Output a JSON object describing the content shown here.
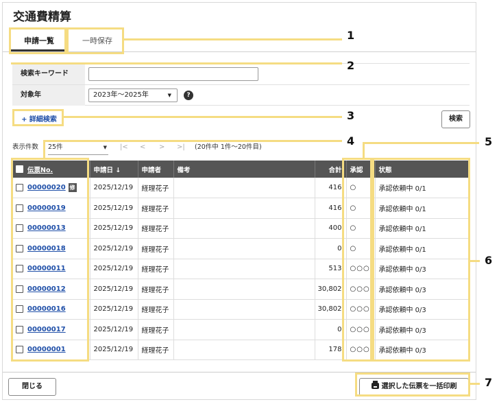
{
  "title": "交通費精算",
  "tabs": [
    {
      "label": "申請一覧",
      "active": true
    },
    {
      "label": "一時保存",
      "active": false
    }
  ],
  "search": {
    "keyword_label": "検索キーワード",
    "keyword_value": "",
    "year_label": "対象年",
    "year_value": "2023年〜2025年",
    "help_icon": "question-circle-icon",
    "detail_link": "+ 詳細検索",
    "search_button": "検索"
  },
  "pager": {
    "page_size_label": "表示件数",
    "page_size": "25件",
    "first": "|<",
    "prev": "<",
    "next": ">",
    "last": ">|",
    "info": "(20件中 1件〜20件目)"
  },
  "table": {
    "headers": {
      "doc_no": "伝票No.",
      "date": "申請日",
      "sort_indicator": "↓",
      "applicant": "申請者",
      "remarks": "備考",
      "total": "合計",
      "approval": "承認",
      "status": "状態"
    },
    "rows": [
      {
        "doc_no": "00000020",
        "badge": "修",
        "date": "2025/12/19",
        "applicant": "経理花子",
        "remarks": "",
        "total": "416",
        "approval": "○",
        "status": "承認依頼中 0/1"
      },
      {
        "doc_no": "00000019",
        "badge": "",
        "date": "2025/12/19",
        "applicant": "経理花子",
        "remarks": "",
        "total": "416",
        "approval": "○",
        "status": "承認依頼中 0/1"
      },
      {
        "doc_no": "00000013",
        "badge": "",
        "date": "2025/12/19",
        "applicant": "経理花子",
        "remarks": "",
        "total": "400",
        "approval": "○",
        "status": "承認依頼中 0/1"
      },
      {
        "doc_no": "00000018",
        "badge": "",
        "date": "2025/12/19",
        "applicant": "経理花子",
        "remarks": "",
        "total": "0",
        "approval": "○",
        "status": "承認依頼中 0/1"
      },
      {
        "doc_no": "00000011",
        "badge": "",
        "date": "2025/12/19",
        "applicant": "経理花子",
        "remarks": "",
        "total": "513",
        "approval": "○○○",
        "status": "承認依頼中 0/3"
      },
      {
        "doc_no": "00000012",
        "badge": "",
        "date": "2025/12/19",
        "applicant": "経理花子",
        "remarks": "",
        "total": "30,802",
        "approval": "○○○",
        "status": "承認依頼中 0/3"
      },
      {
        "doc_no": "00000016",
        "badge": "",
        "date": "2025/12/19",
        "applicant": "経理花子",
        "remarks": "",
        "total": "30,802",
        "approval": "○○○",
        "status": "承認依頼中 0/3"
      },
      {
        "doc_no": "00000017",
        "badge": "",
        "date": "2025/12/19",
        "applicant": "経理花子",
        "remarks": "",
        "total": "0",
        "approval": "○○○",
        "status": "承認依頼中 0/3"
      },
      {
        "doc_no": "00000001",
        "badge": "",
        "date": "2025/12/19",
        "applicant": "経理花子",
        "remarks": "",
        "total": "178",
        "approval": "○○○",
        "status": "承認依頼中 0/3"
      }
    ]
  },
  "footer": {
    "close_button": "閉じる",
    "print_button": "選択した伝票を一括印刷",
    "print_icon": "printer-icon"
  },
  "annotations": [
    "1",
    "2",
    "3",
    "4",
    "5",
    "6",
    "7"
  ],
  "colors": {
    "accent": "#1f4fa8",
    "header_bg": "#555555",
    "highlight": "#f5dc82"
  }
}
